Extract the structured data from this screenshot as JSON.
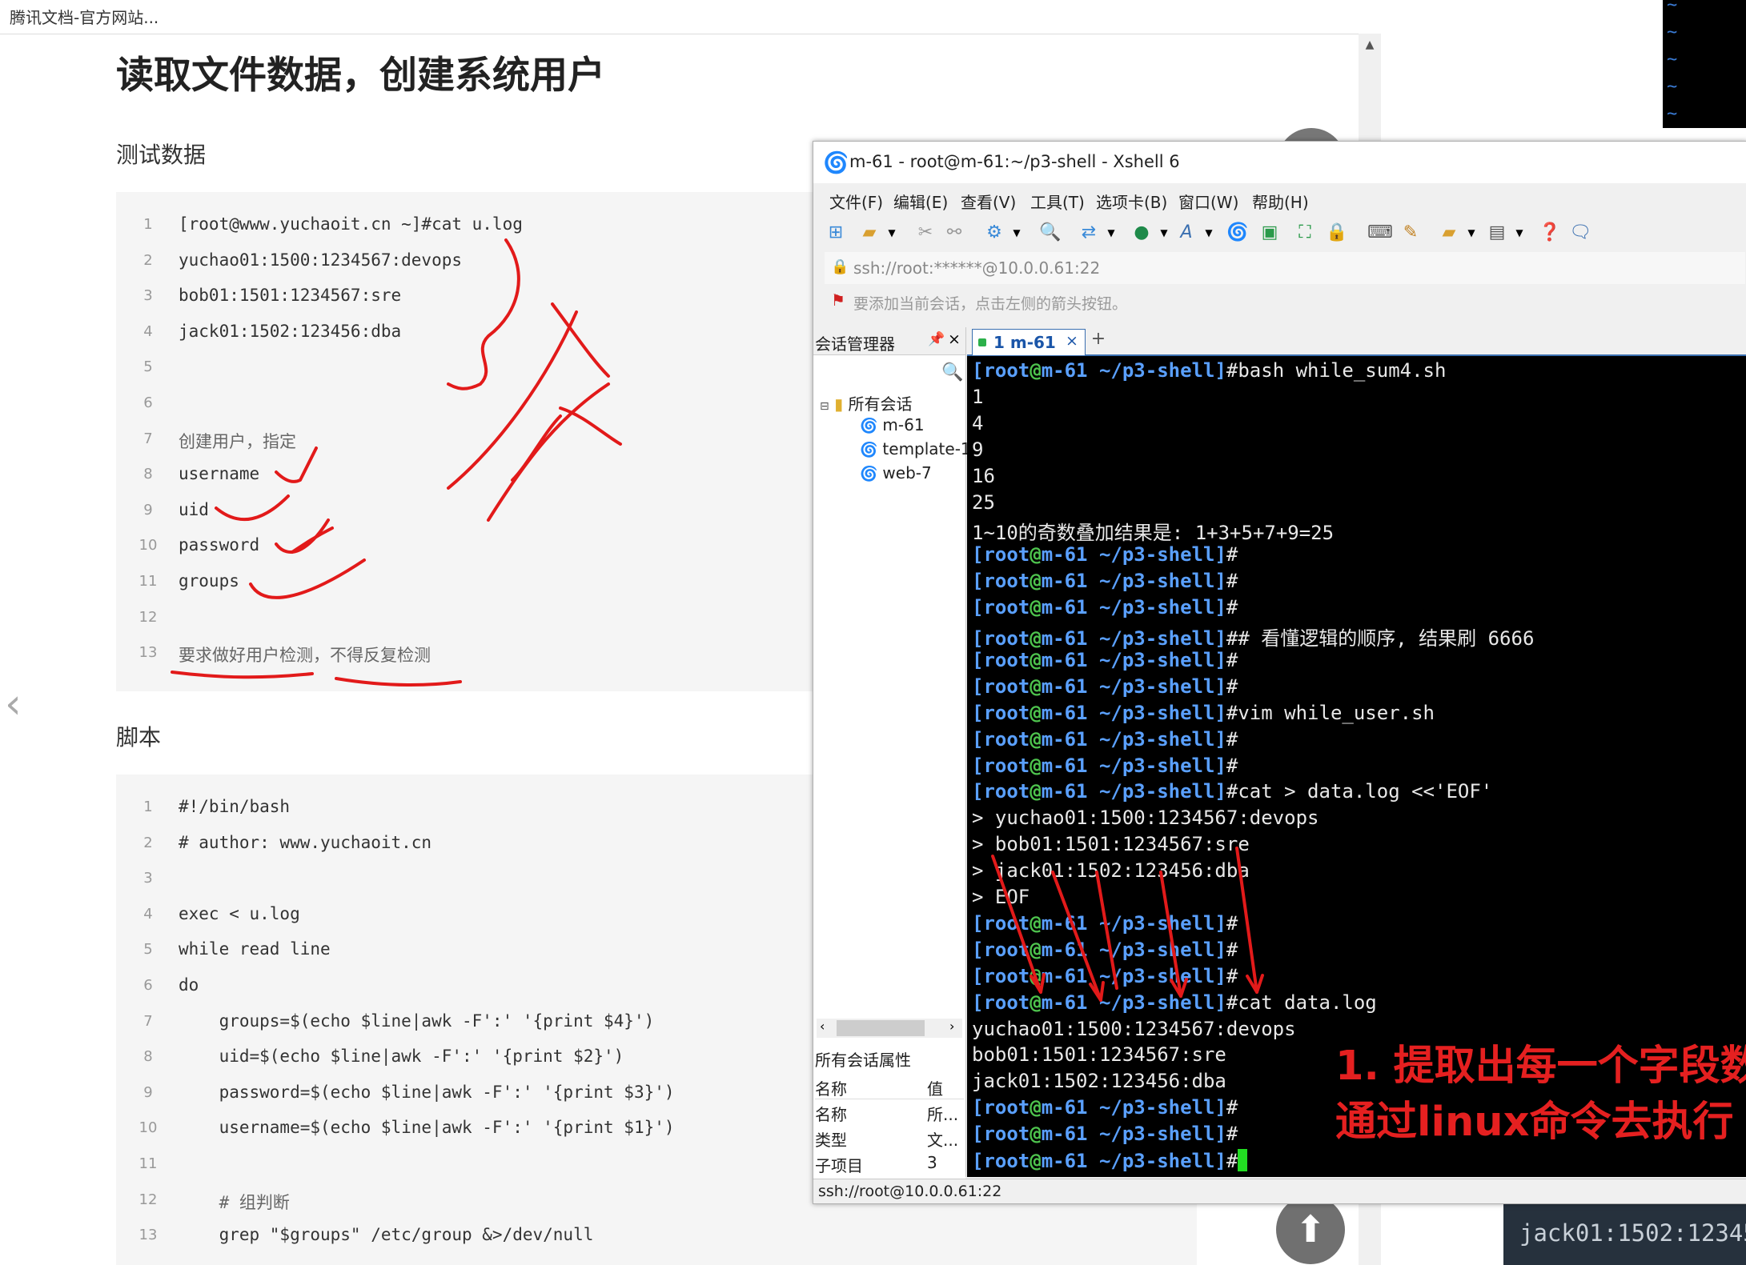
{
  "browser": {
    "tab_title": "腾讯文档-官方网站..."
  },
  "doc": {
    "title": "读取文件数据，创建系统用户",
    "section1": "测试数据",
    "section2": "脚本",
    "test_data": [
      {
        "n": "1",
        "text": "[root@www.yuchaoit.cn ~]#cat u.log"
      },
      {
        "n": "2",
        "text": "yuchao01:1500:1234567:devops"
      },
      {
        "n": "3",
        "text": "bob01:1501:1234567:sre"
      },
      {
        "n": "4",
        "text": "jack01:1502:123456:dba"
      },
      {
        "n": "5",
        "text": ""
      },
      {
        "n": "6",
        "text": ""
      },
      {
        "n": "7",
        "text": "创建用户，指定"
      },
      {
        "n": "8",
        "text": "username"
      },
      {
        "n": "9",
        "text": "uid"
      },
      {
        "n": "10",
        "text": "password"
      },
      {
        "n": "11",
        "text": "groups"
      },
      {
        "n": "12",
        "text": ""
      },
      {
        "n": "13",
        "text": "要求做好用户检测，不得反复检测"
      }
    ],
    "script": [
      {
        "n": "1",
        "text": "#!/bin/bash"
      },
      {
        "n": "2",
        "text": "# author: www.yuchaoit.cn"
      },
      {
        "n": "3",
        "text": ""
      },
      {
        "n": "4",
        "text": "exec < u.log"
      },
      {
        "n": "5",
        "text": "while read line"
      },
      {
        "n": "6",
        "text": "do"
      },
      {
        "n": "7",
        "text": "    groups=$(echo $line|awk -F':' '{print $4}')"
      },
      {
        "n": "8",
        "text": "    uid=$(echo $line|awk -F':' '{print $2}')"
      },
      {
        "n": "9",
        "text": "    password=$(echo $line|awk -F':' '{print $3}')"
      },
      {
        "n": "10",
        "text": "    username=$(echo $line|awk -F':' '{print $1}')"
      },
      {
        "n": "11",
        "text": ""
      },
      {
        "n": "12",
        "text": "    # 组判断"
      },
      {
        "n": "13",
        "text": "    grep \"$groups\" /etc/group &>/dev/null"
      }
    ]
  },
  "xshell": {
    "title": "m-61 - root@m-61:~/p3-shell - Xshell 6",
    "menu": [
      "文件(F)",
      "编辑(E)",
      "查看(V)",
      "工具(T)",
      "选项卡(B)",
      "窗口(W)",
      "帮助(H)"
    ],
    "address": "ssh://root:******@10.0.0.61:22",
    "hint": "要添加当前会话，点击左侧的箭头按钮。",
    "session_manager": {
      "title": "会话管理器",
      "root": "所有会话",
      "items": [
        "m-61",
        "template-1",
        "web-7"
      ]
    },
    "properties": {
      "title": "所有会话属性",
      "header": {
        "k": "名称",
        "v": "值"
      },
      "rows": [
        {
          "k": "名称",
          "v": "所..."
        },
        {
          "k": "类型",
          "v": "文..."
        },
        {
          "k": "子项目",
          "v": "3"
        }
      ]
    },
    "tab": {
      "label": "1 m-61",
      "close": "×",
      "add": "+"
    },
    "prompt": {
      "user": "root",
      "host": "m-61",
      "path": "~/p3-shell"
    },
    "terminal": [
      {
        "p": true,
        "cmd": "bash while_sum4.sh"
      },
      {
        "p": false,
        "out": "1"
      },
      {
        "p": false,
        "out": "4"
      },
      {
        "p": false,
        "out": "9"
      },
      {
        "p": false,
        "out": "16"
      },
      {
        "p": false,
        "out": "25"
      },
      {
        "p": false,
        "out": "1~10的奇数叠加结果是: 1+3+5+7+9=25"
      },
      {
        "p": true,
        "cmd": ""
      },
      {
        "p": true,
        "cmd": ""
      },
      {
        "p": true,
        "cmd": ""
      },
      {
        "p": true,
        "cmd": "# 看懂逻辑的顺序, 结果刷 6666"
      },
      {
        "p": true,
        "cmd": ""
      },
      {
        "p": true,
        "cmd": ""
      },
      {
        "p": true,
        "cmd": "vim while_user.sh"
      },
      {
        "p": true,
        "cmd": ""
      },
      {
        "p": true,
        "cmd": ""
      },
      {
        "p": true,
        "cmd": "cat > data.log <<'EOF'"
      },
      {
        "p": false,
        "out": "> yuchao01:1500:1234567:devops"
      },
      {
        "p": false,
        "out": "> bob01:1501:1234567:sre"
      },
      {
        "p": false,
        "out": "> jack01:1502:123456:dba"
      },
      {
        "p": false,
        "out": "> EOF"
      },
      {
        "p": true,
        "cmd": ""
      },
      {
        "p": true,
        "cmd": ""
      },
      {
        "p": true,
        "cmd": ""
      },
      {
        "p": true,
        "cmd": "cat data.log"
      },
      {
        "p": false,
        "out": "yuchao01:1500:1234567:devops"
      },
      {
        "p": false,
        "out": "bob01:1501:1234567:sre"
      },
      {
        "p": false,
        "out": "jack01:1502:123456:dba"
      },
      {
        "p": true,
        "cmd": ""
      },
      {
        "p": true,
        "cmd": ""
      },
      {
        "p": true,
        "cmd": "",
        "cursor": true
      }
    ],
    "status": "ssh://root@10.0.0.61:22"
  },
  "annotation": {
    "line1": "1. 提取出每一个字段数",
    "line2": "通过linux命令去执行"
  },
  "bottom_strip": "jack01:1502:12345",
  "vim_tildes": [
    "~",
    "~",
    "~",
    "~",
    "~"
  ]
}
